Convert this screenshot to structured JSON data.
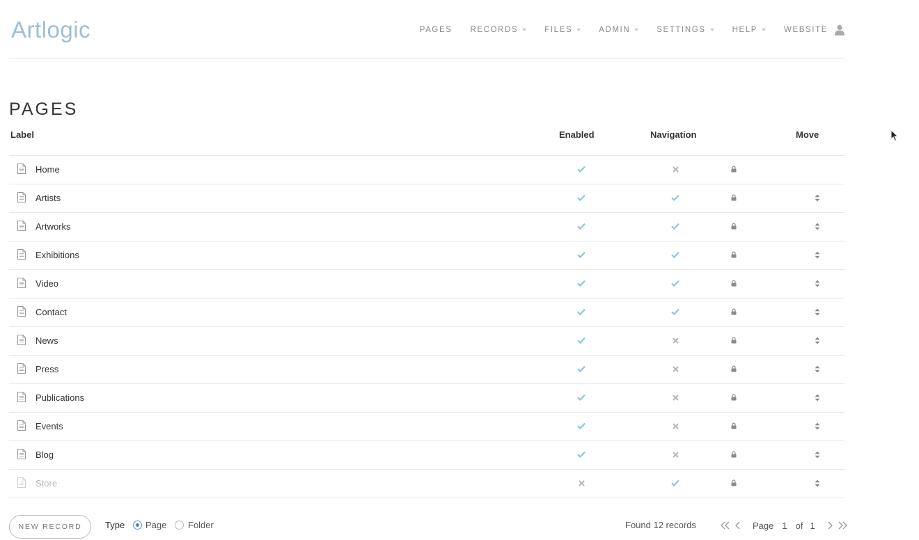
{
  "header": {
    "logo": "Artlogic",
    "nav": [
      {
        "label": "PAGES",
        "dropdown": false
      },
      {
        "label": "RECORDS",
        "dropdown": true
      },
      {
        "label": "FILES",
        "dropdown": true
      },
      {
        "label": "ADMIN",
        "dropdown": true
      },
      {
        "label": "SETTINGS",
        "dropdown": true
      },
      {
        "label": "HELP",
        "dropdown": true
      },
      {
        "label": "WEBSITE",
        "dropdown": false
      }
    ]
  },
  "page": {
    "title": "PAGES"
  },
  "table": {
    "columns": {
      "label": "Label",
      "enabled": "Enabled",
      "navigation": "Navigation",
      "move": "Move"
    },
    "rows": [
      {
        "label": "Home",
        "enabled": true,
        "navigation": false,
        "locked": true,
        "movable": false,
        "disabled": false
      },
      {
        "label": "Artists",
        "enabled": true,
        "navigation": true,
        "locked": true,
        "movable": true,
        "disabled": false
      },
      {
        "label": "Artworks",
        "enabled": true,
        "navigation": true,
        "locked": true,
        "movable": true,
        "disabled": false
      },
      {
        "label": "Exhibitions",
        "enabled": true,
        "navigation": true,
        "locked": true,
        "movable": true,
        "disabled": false
      },
      {
        "label": "Video",
        "enabled": true,
        "navigation": true,
        "locked": true,
        "movable": true,
        "disabled": false
      },
      {
        "label": "Contact",
        "enabled": true,
        "navigation": true,
        "locked": true,
        "movable": true,
        "disabled": false
      },
      {
        "label": "News",
        "enabled": true,
        "navigation": false,
        "locked": true,
        "movable": true,
        "disabled": false
      },
      {
        "label": "Press",
        "enabled": true,
        "navigation": false,
        "locked": true,
        "movable": true,
        "disabled": false
      },
      {
        "label": "Publications",
        "enabled": true,
        "navigation": false,
        "locked": true,
        "movable": true,
        "disabled": false
      },
      {
        "label": "Events",
        "enabled": true,
        "navigation": false,
        "locked": true,
        "movable": true,
        "disabled": false
      },
      {
        "label": "Blog",
        "enabled": true,
        "navigation": false,
        "locked": true,
        "movable": true,
        "disabled": false
      },
      {
        "label": "Store",
        "enabled": false,
        "navigation": true,
        "locked": true,
        "movable": true,
        "disabled": true
      }
    ]
  },
  "footer": {
    "new_record_label": "NEW RECORD",
    "type_label": "Type",
    "type_options": [
      {
        "label": "Page",
        "checked": true
      },
      {
        "label": "Folder",
        "checked": false
      }
    ],
    "found_text": "Found 12 records",
    "pager": {
      "page_label": "Page",
      "current": "1",
      "of_label": "of",
      "total": "1"
    }
  },
  "colors": {
    "check": "#8fc4dd",
    "cross": "#b5b5b5",
    "accent_radio": "#4a7fd4",
    "logo": "#9cc0d6"
  }
}
